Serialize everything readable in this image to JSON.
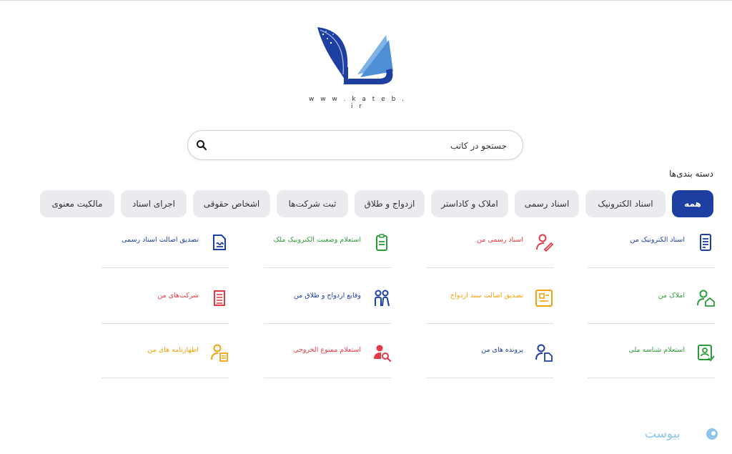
{
  "logo": {
    "url_text": "w w w . k a t e b . i r"
  },
  "search": {
    "placeholder": "جستجو در کاتب"
  },
  "categories": {
    "heading": "دسته بندی‌ها",
    "chips": [
      "همه",
      "اسناد الکترونیک",
      "اسناد رسمی",
      "املاک و کاداستر",
      "ازدواج و طلاق",
      "ثبت شرکت‌ها",
      "اشخاص حقوقی",
      "اجرای اسناد",
      "مالکیت معنوی"
    ],
    "active_index": 0
  },
  "services": [
    {
      "label": "اسناد الکترونیک من",
      "color": "#1d3fa1",
      "icon": "document-icon"
    },
    {
      "label": "اسناد رسمی من",
      "color": "#e63946",
      "icon": "user-pen-icon"
    },
    {
      "label": "استعلام وضعیت الکترونیک ملک",
      "color": "#2e9b3a",
      "icon": "clipboard-list-icon"
    },
    {
      "label": "تصدیق اصالت اسناد رسمی",
      "color": "#1d3fa1",
      "icon": "document-check-icon"
    },
    {
      "label": "املاک من",
      "color": "#2e9b3a",
      "icon": "user-home-icon"
    },
    {
      "label": "تصدیق اصالت سند ازدواج",
      "color": "#f2a20c",
      "icon": "certificate-icon"
    },
    {
      "label": "وقایع ازدواج و طلاق من",
      "color": "#1d3fa1",
      "icon": "couple-icon"
    },
    {
      "label": "شرکت‌های من",
      "color": "#e63946",
      "icon": "building-icon"
    },
    {
      "label": "استعلام شناسه ملی",
      "color": "#2e9b3a",
      "icon": "id-check-icon"
    },
    {
      "label": "پرونده های من",
      "color": "#1d3fa1",
      "icon": "user-file-icon"
    },
    {
      "label": "استعلام ممنوع الخروجی",
      "color": "#e63946",
      "icon": "user-search-icon"
    },
    {
      "label": "اظهارنامه های من",
      "color": "#f2a20c",
      "icon": "user-doc-icon"
    }
  ],
  "watermark": {
    "text": "بیوست"
  }
}
